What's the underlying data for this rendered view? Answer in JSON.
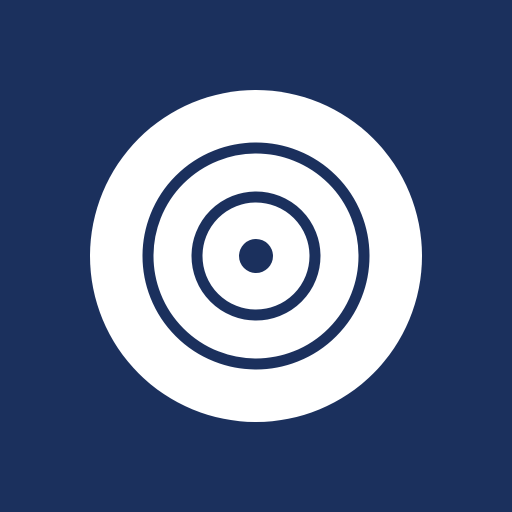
{
  "icon": {
    "name": "target-icon",
    "background_color": "#1B305D",
    "foreground_color": "#FFFFFF",
    "accent_color": "#1B305D"
  }
}
